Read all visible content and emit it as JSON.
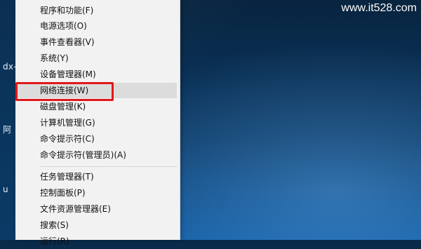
{
  "watermark": "www.it528.com",
  "desktop": {
    "left_fragments": [
      "dx-",
      "阿",
      "u"
    ]
  },
  "context_menu": {
    "items": [
      {
        "label": "程序和功能(F)"
      },
      {
        "label": "电源选项(O)"
      },
      {
        "label": "事件查看器(V)"
      },
      {
        "label": "系统(Y)"
      },
      {
        "label": "设备管理器(M)"
      },
      {
        "label": "网络连接(W)",
        "state": "hovered",
        "annotated": true
      },
      {
        "label": "磁盘管理(K)"
      },
      {
        "label": "计算机管理(G)"
      },
      {
        "label": "命令提示符(C)"
      },
      {
        "label": "命令提示符(管理员)(A)"
      },
      {
        "label": "任务管理器(T)"
      },
      {
        "label": "控制面板(P)"
      },
      {
        "label": "文件资源管理器(E)"
      },
      {
        "label": "搜索(S)"
      },
      {
        "label": "运行(R)"
      }
    ]
  },
  "colors": {
    "highlight_box": "#e01919",
    "menu_bg": "#f2f2f2",
    "hover_bg": "#dcdcdc",
    "desktop_blue": "#0b3b68"
  }
}
